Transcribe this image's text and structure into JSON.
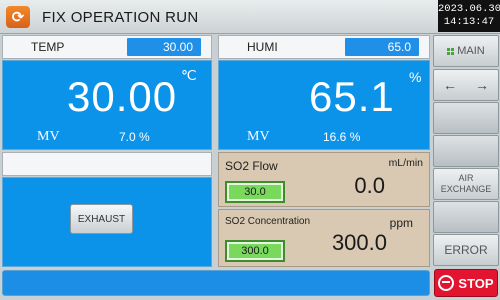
{
  "header": {
    "title": "FIX OPERATION RUN",
    "date": "2023.06.30",
    "time": "14:13:47"
  },
  "temp": {
    "label": "TEMP",
    "setpoint": "30.00",
    "value": "30.00",
    "unit": "℃",
    "mv_label": "MV",
    "mv_value": "7.0 %"
  },
  "humi": {
    "label": "HUMI",
    "setpoint": "65.0",
    "value": "65.1",
    "unit": "%",
    "mv_label": "MV",
    "mv_value": "16.6 %"
  },
  "exhaust": {
    "label": "EXHAUST"
  },
  "so2_flow": {
    "title": "SO2 Flow",
    "unit": "mL/min",
    "setpoint": "30.0",
    "value": "0.0"
  },
  "so2_conc": {
    "title": "SO2 Concentration",
    "unit": "ppm",
    "setpoint": "300.0",
    "value": "300.0"
  },
  "menu": {
    "main": "MAIN",
    "back_arrow": "←",
    "forward_arrow": "→",
    "air_exchange": "AIR EXCHANGE",
    "error": "ERROR",
    "stop": "STOP"
  },
  "colors": {
    "panel_blue": "#0b93ea",
    "so2_bg": "#d9c9b2",
    "stop_red": "#e2142f",
    "set_green": "#79d95c"
  }
}
